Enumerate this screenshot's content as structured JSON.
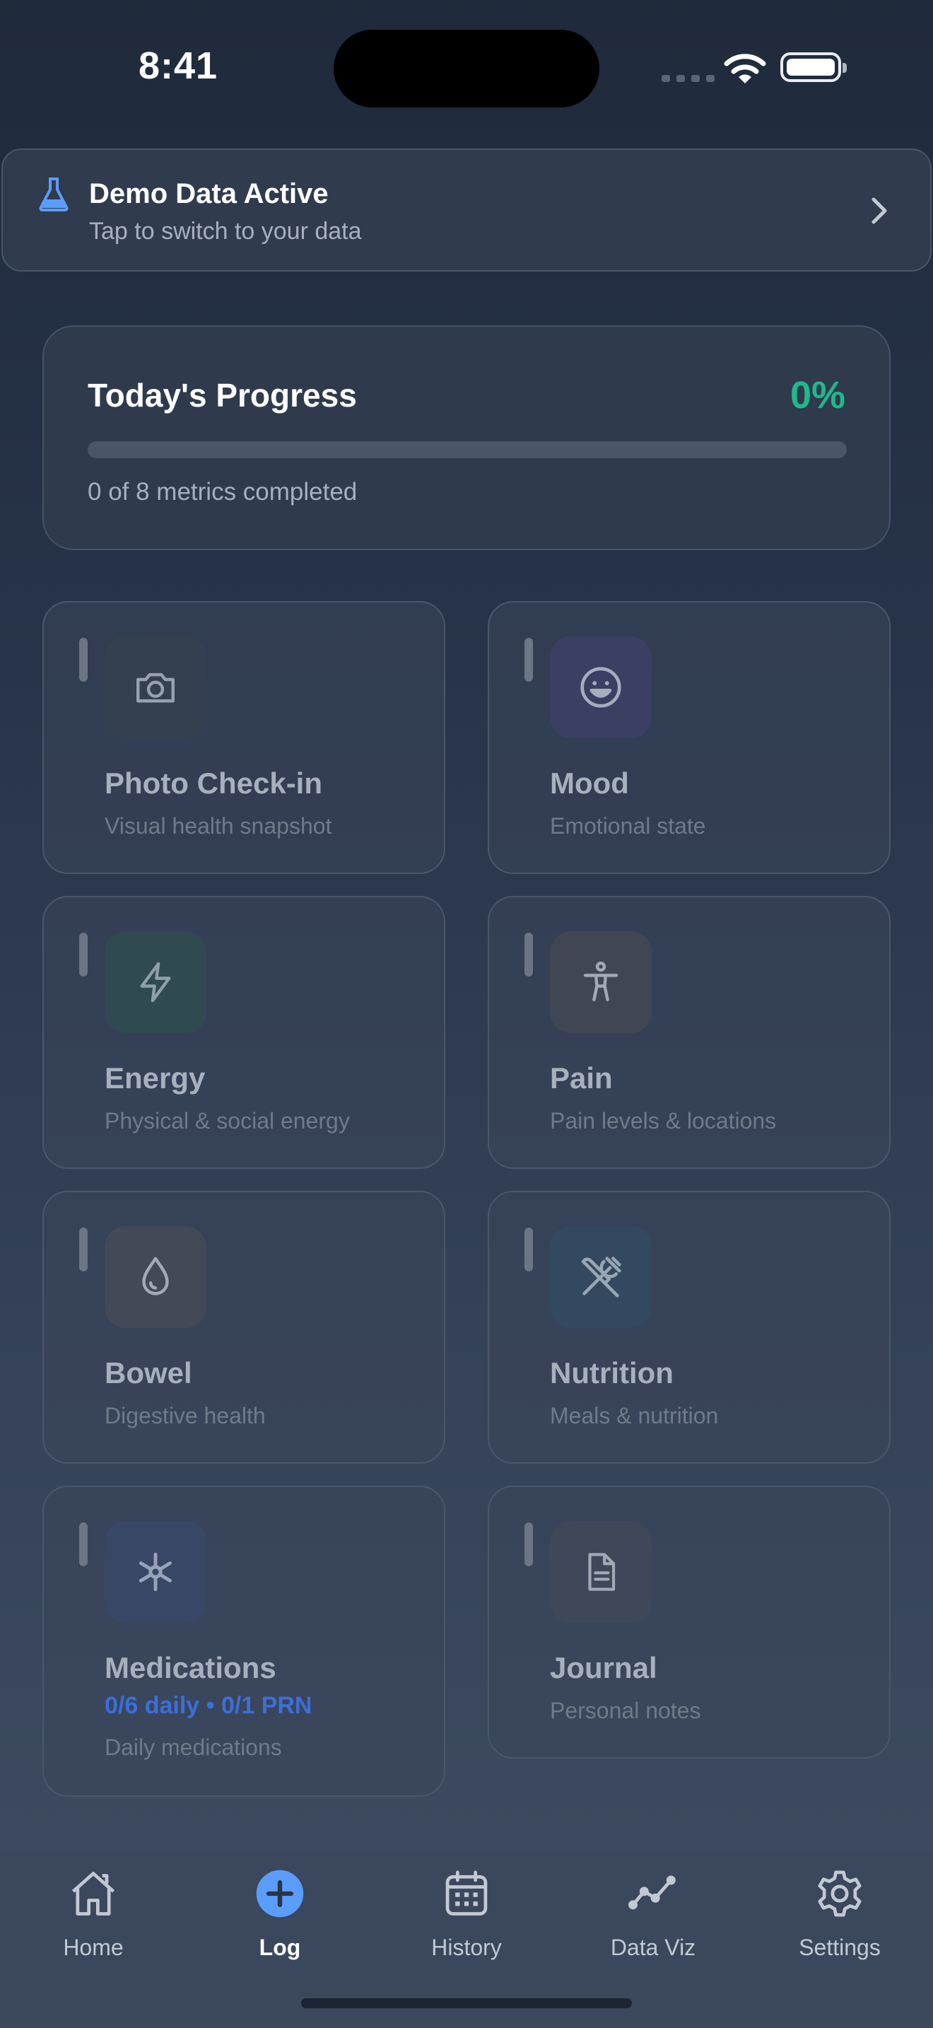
{
  "status_bar": {
    "time": "8:41"
  },
  "demo_banner": {
    "title": "Demo Data Active",
    "subtitle": "Tap to switch to your data",
    "icon": "flask-icon",
    "accent": "#5b9dff"
  },
  "progress": {
    "title": "Today's Progress",
    "percent_label": "0%",
    "percent": 0,
    "summary": "0 of 8 metrics completed",
    "accent": "#1fb98c"
  },
  "metrics": [
    {
      "title": "Photo Check-in",
      "subtitle": "Visual health snapshot",
      "icon": "camera-icon"
    },
    {
      "title": "Mood",
      "subtitle": "Emotional state",
      "icon": "smile-icon"
    },
    {
      "title": "Energy",
      "subtitle": "Physical & social energy",
      "icon": "lightning-icon"
    },
    {
      "title": "Pain",
      "subtitle": "Pain levels & locations",
      "icon": "person-icon"
    },
    {
      "title": "Bowel",
      "subtitle": "Digestive health",
      "icon": "droplet-icon"
    },
    {
      "title": "Nutrition",
      "subtitle": "Meals & nutrition",
      "icon": "utensils-icon"
    },
    {
      "title": "Medications",
      "status": "0/6 daily • 0/1 PRN",
      "subtitle": "Daily medications",
      "icon": "asterisk-icon"
    },
    {
      "title": "Journal",
      "subtitle": "Personal notes",
      "icon": "document-icon"
    }
  ],
  "tabbar": {
    "items": [
      {
        "label": "Home",
        "icon": "home-icon"
      },
      {
        "label": "Log",
        "icon": "plus-circle-icon",
        "active": true
      },
      {
        "label": "History",
        "icon": "calendar-icon"
      },
      {
        "label": "Data Viz",
        "icon": "line-chart-icon"
      },
      {
        "label": "Settings",
        "icon": "gear-icon"
      }
    ],
    "accent": "#5b9dff"
  }
}
